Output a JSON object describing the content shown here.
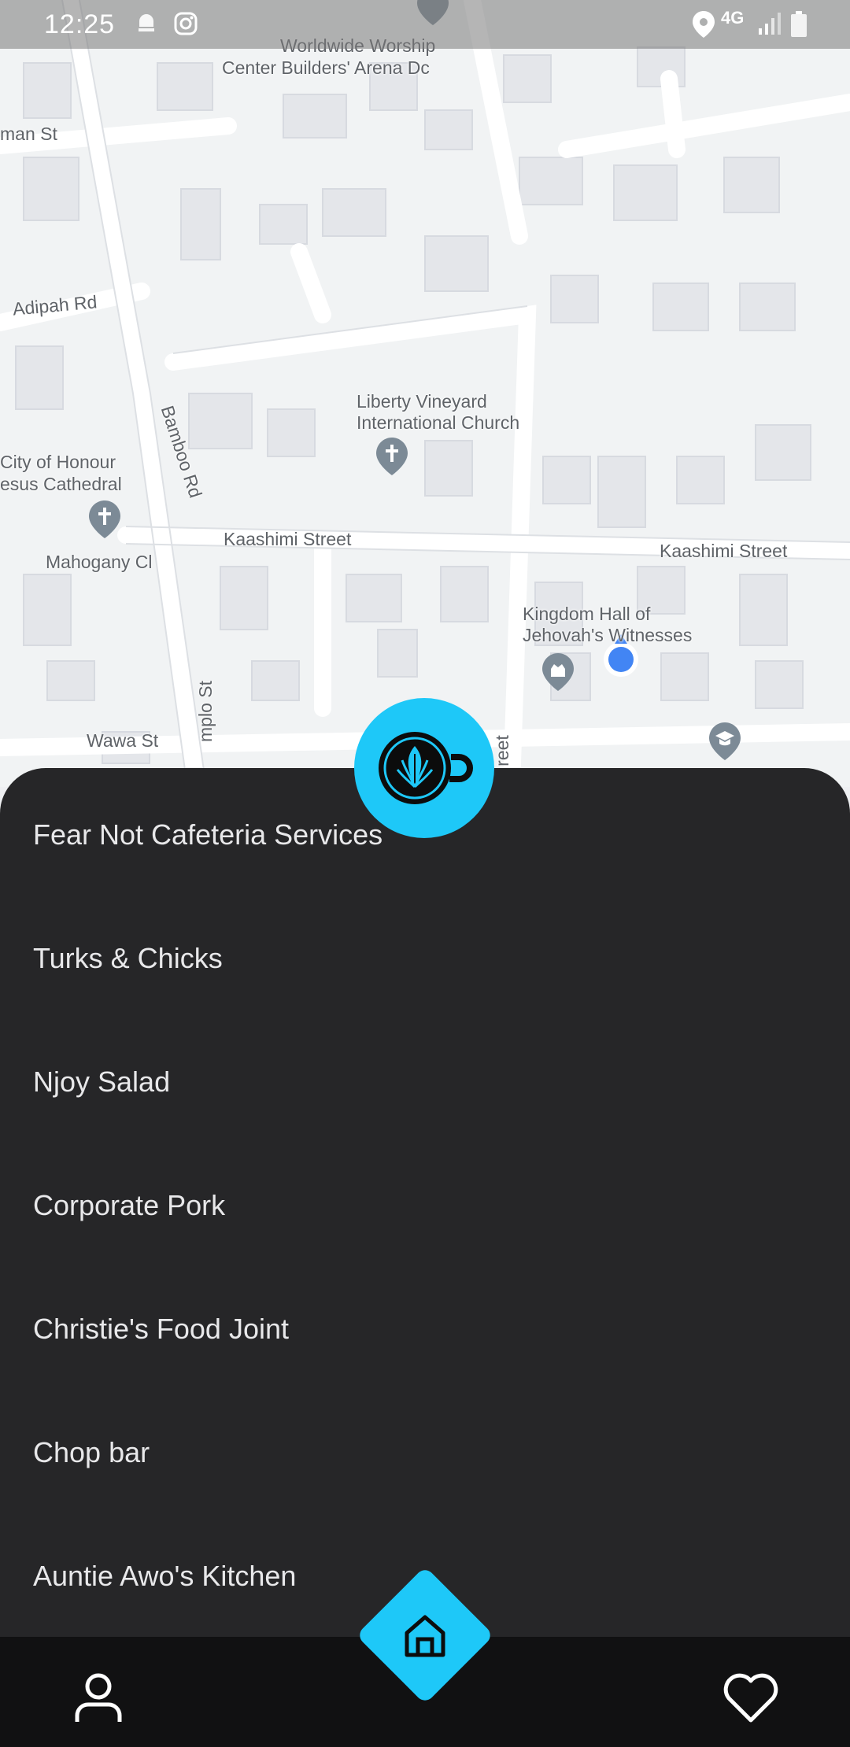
{
  "status_bar": {
    "time": "12:25",
    "network": "4G"
  },
  "map": {
    "streets": [
      "man St",
      "Adipah Rd",
      "Bamboo Rd",
      "Kaashimi Street",
      "Kaashimi Street",
      "Mahogany Cl",
      "Wawa St",
      "mplo St",
      "reet"
    ],
    "places": [
      "Worldwide Worship",
      "Center Builders' Arena Dc",
      "Liberty Vineyard",
      "International Church",
      "City of Honour",
      "esus Cathedral",
      "Kingdom Hall of",
      "Jehovah's Witnesses"
    ]
  },
  "restaurants": [
    "Fear Not Cafeteria Services",
    "Turks & Chicks",
    "Njoy Salad",
    "Corporate Pork",
    "Christie's Food Joint",
    "Chop bar",
    "Auntie Awo's Kitchen"
  ],
  "icons": {
    "logo": "latte-art-cup-icon",
    "profile": "person-icon",
    "home": "home-icon",
    "favorite": "heart-icon"
  },
  "colors": {
    "accent": "#1ec8f8",
    "sheet": "#262628",
    "nav": "#111112",
    "location_dot": "#4285f4"
  }
}
